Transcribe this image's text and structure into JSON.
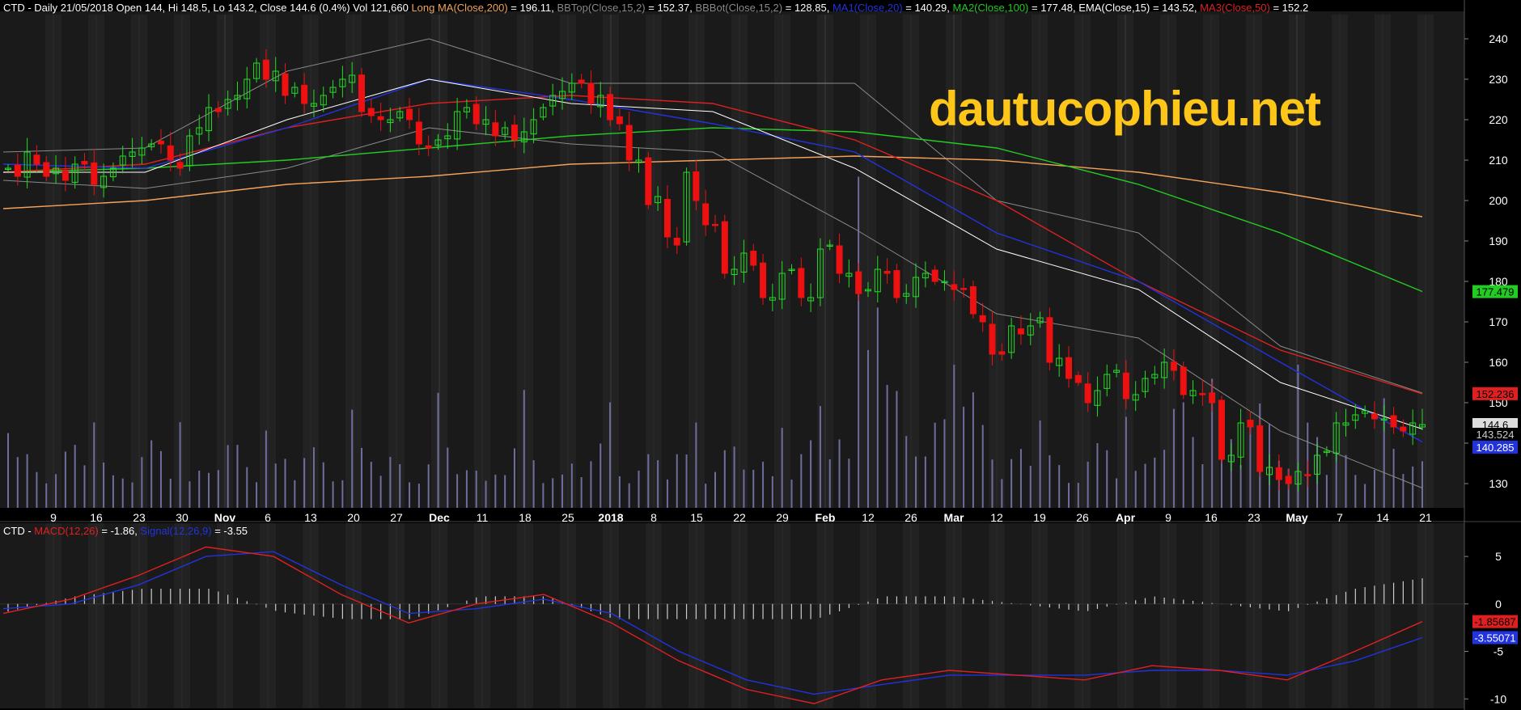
{
  "header": {
    "main": [
      {
        "text": "CTD - Daily 21/05/2018 Open 144, Hi 148.5, Lo 143.2, Close 144.6 (0.4%) Vol 121,660 ",
        "color": "#FFFFFF"
      },
      {
        "text": "Long MA(Close,200)",
        "color": "#F4A35A"
      },
      {
        "text": " = 196.11, ",
        "color": "#FFFFFF"
      },
      {
        "text": "BBTop(Close,15,2)",
        "color": "#8A8A8A"
      },
      {
        "text": " = 152.37, ",
        "color": "#FFFFFF"
      },
      {
        "text": "BBBot(Close,15,2)",
        "color": "#8A8A8A"
      },
      {
        "text": " = 128.85, ",
        "color": "#FFFFFF"
      },
      {
        "text": "MA1(Close,20)",
        "color": "#2233DD"
      },
      {
        "text": " = 140.29, ",
        "color": "#FFFFFF"
      },
      {
        "text": "MA2(Close,100)",
        "color": "#22CC22"
      },
      {
        "text": " = 177.48, ",
        "color": "#FFFFFF"
      },
      {
        "text": "EMA(Close,15)",
        "color": "#FFFFFF"
      },
      {
        "text": " = 143.52, ",
        "color": "#FFFFFF"
      },
      {
        "text": "MA3(Close,50)",
        "color": "#E02020"
      },
      {
        "text": " = 152.2",
        "color": "#FFFFFF"
      }
    ],
    "macd": [
      {
        "text": "CTD - ",
        "color": "#FFFFFF"
      },
      {
        "text": "MACD(12,26)",
        "color": "#E02020"
      },
      {
        "text": " = -1.86, ",
        "color": "#FFFFFF"
      },
      {
        "text": "Signal(12,26,9)",
        "color": "#2233DD"
      },
      {
        "text": " = -3.55",
        "color": "#FFFFFF"
      }
    ]
  },
  "watermark": "dautucophieu.net",
  "colors": {
    "up": "#22DD22",
    "down": "#EE1111",
    "ma200": "#F4A35A",
    "ma100": "#22CC22",
    "ma50": "#E02020",
    "ma20": "#2233DD",
    "ema15": "#FFFFFF",
    "bb": "#8A8A8A",
    "volume": "#6E6E9E",
    "macd": "#E02020",
    "signal": "#2233DD",
    "hist": "#CCCCCC"
  },
  "chart_data": [
    {
      "type": "candlestick",
      "ylim": [
        124,
        246
      ],
      "yticks": [
        130,
        140,
        150,
        160,
        170,
        180,
        190,
        200,
        210,
        220,
        230,
        240
      ],
      "xticks": [
        "9",
        "16",
        "23",
        "30",
        "Nov",
        "6",
        "13",
        "20",
        "27",
        "Dec",
        "11",
        "18",
        "25",
        "2018",
        "8",
        "15",
        "22",
        "29",
        "Feb",
        "12",
        "26",
        "Mar",
        "12",
        "19",
        "26",
        "Apr",
        "9",
        "16",
        "23",
        "May",
        "7",
        "14",
        "21"
      ],
      "xtick_bold": [
        "Nov",
        "Dec",
        "2018",
        "Feb",
        "Mar",
        "Apr",
        "May"
      ],
      "anchors": [
        [
          208,
          206
        ],
        [
          212,
          209
        ],
        [
          206,
          208
        ],
        [
          205,
          209
        ],
        [
          209,
          204
        ],
        [
          206,
          208
        ],
        [
          211,
          212
        ],
        [
          213,
          214
        ],
        [
          214,
          210
        ],
        [
          208,
          216
        ],
        [
          218,
          223
        ],
        [
          222,
          225
        ],
        [
          226,
          230
        ],
        [
          234,
          230
        ],
        [
          232,
          226
        ],
        [
          228,
          224
        ],
        [
          224,
          226
        ],
        [
          228,
          230
        ],
        [
          231,
          222
        ],
        [
          221,
          220
        ],
        [
          220,
          222
        ],
        [
          220,
          214
        ],
        [
          213,
          215
        ],
        [
          216,
          222
        ],
        [
          223,
          219
        ],
        [
          220,
          216
        ],
        [
          218,
          215
        ],
        [
          217,
          220
        ],
        [
          223,
          226
        ],
        [
          227,
          229
        ],
        [
          229,
          224
        ],
        [
          226,
          220
        ],
        [
          219,
          210
        ],
        [
          210,
          199
        ],
        [
          201,
          191
        ],
        [
          189,
          207
        ],
        [
          200,
          194
        ],
        [
          194,
          182
        ],
        [
          183,
          187
        ],
        [
          184,
          176
        ],
        [
          176,
          182
        ],
        [
          183,
          176
        ],
        [
          176,
          188
        ],
        [
          189,
          182
        ],
        [
          182,
          177
        ],
        [
          178,
          183
        ],
        [
          182,
          176
        ],
        [
          177,
          181
        ],
        [
          182,
          180
        ],
        [
          180,
          178
        ],
        [
          178,
          172
        ],
        [
          170,
          162
        ],
        [
          162,
          169
        ],
        [
          167,
          169
        ],
        [
          171,
          160
        ],
        [
          161,
          156
        ],
        [
          155,
          150
        ],
        [
          153,
          157
        ],
        [
          158,
          151
        ],
        [
          152,
          156
        ],
        [
          157,
          160
        ],
        [
          158,
          152
        ],
        [
          153,
          152
        ],
        [
          150,
          136
        ],
        [
          137,
          145
        ],
        [
          144,
          133
        ],
        [
          134,
          131
        ],
        [
          130,
          133
        ],
        [
          132,
          137
        ],
        [
          138,
          145
        ],
        [
          145,
          147
        ],
        [
          148,
          146
        ],
        [
          146,
          144
        ],
        [
          143,
          145
        ]
      ],
      "ma200": [
        198,
        200,
        204,
        206,
        209,
        210,
        211,
        210,
        207,
        202,
        196
      ],
      "ma100": [
        207,
        208,
        210,
        213,
        216,
        218,
        217,
        213,
        204,
        192,
        177.5
      ],
      "ma50": [
        207,
        209,
        218,
        224,
        226,
        224,
        215,
        200,
        180,
        163,
        152.2
      ],
      "ma20": [
        209,
        208,
        218,
        230,
        225,
        219,
        212,
        192,
        180,
        160,
        140.3
      ],
      "ema15": [
        207,
        207,
        220,
        230,
        224,
        222,
        208,
        188,
        178,
        155,
        143.5
      ],
      "bbtop": [
        212,
        213,
        232,
        240,
        229,
        229,
        229,
        200,
        192,
        164,
        152.4
      ],
      "bbbot": [
        205,
        203,
        208,
        218,
        214,
        212,
        193,
        172,
        166,
        143,
        128.9
      ],
      "volume_max": 200000,
      "last_labels": [
        {
          "text": "177.479",
          "value": 177.479,
          "bg": "#22CC22",
          "fg": "#000000"
        },
        {
          "text": "152.236",
          "value": 152.236,
          "bg": "#E02020",
          "fg": "#000000"
        },
        {
          "text": "144.6",
          "value": 144.6,
          "bg": "#DDDDDD",
          "fg": "#000000"
        },
        {
          "text": "143.524",
          "value": 142.2,
          "bg": "#000000",
          "fg": "#CCCCCC"
        },
        {
          "text": "140.285",
          "value": 139.0,
          "bg": "#2233DD",
          "fg": "#FFFFFF"
        }
      ]
    },
    {
      "type": "line",
      "ylim": [
        -11,
        8.5
      ],
      "yticks": [
        5,
        0,
        -5,
        -10
      ],
      "macd": [
        -1,
        0.5,
        3,
        6,
        5,
        1,
        -2,
        0,
        1,
        -2,
        -6,
        -9,
        -10.5,
        -8,
        -7,
        -7.5,
        -8,
        -6.5,
        -7,
        -8,
        -5,
        -1.86
      ],
      "signal": [
        -0.5,
        0,
        2,
        5,
        5.5,
        2,
        -1,
        -0.5,
        0.5,
        -1,
        -5,
        -8,
        -9.5,
        -8.5,
        -7.5,
        -7.5,
        -7.5,
        -7,
        -7,
        -7.5,
        -6,
        -3.55
      ],
      "last_labels": [
        {
          "text": "-1.85687",
          "value": -1.86,
          "bg": "#E02020",
          "fg": "#000000"
        },
        {
          "text": "-3.55071",
          "value": -3.55,
          "bg": "#2233DD",
          "fg": "#FFFFFF"
        }
      ]
    }
  ]
}
